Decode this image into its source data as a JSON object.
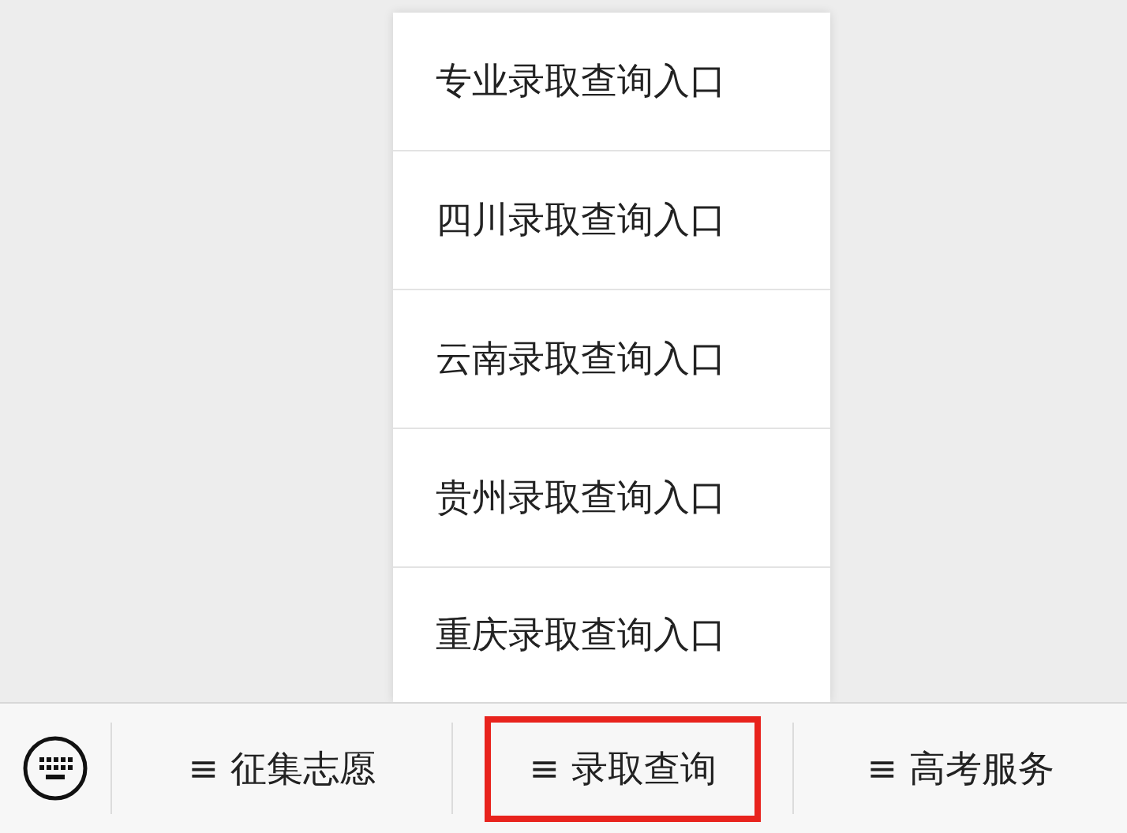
{
  "popup_menu": {
    "items": [
      {
        "label": "专业录取查询入口"
      },
      {
        "label": "四川录取查询入口"
      },
      {
        "label": "云南录取查询入口"
      },
      {
        "label": "贵州录取查询入口"
      },
      {
        "label": "重庆录取查询入口"
      }
    ]
  },
  "bottom_menu": {
    "items": [
      {
        "label": "≡ 征集志愿",
        "highlighted": false
      },
      {
        "label": "≡ 录取查询",
        "highlighted": true
      },
      {
        "label": "≡ 高考服务",
        "highlighted": false
      }
    ]
  }
}
